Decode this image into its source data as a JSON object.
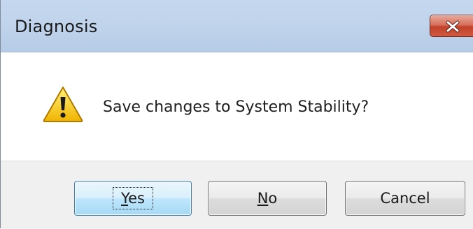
{
  "window": {
    "title": "Diagnosis"
  },
  "message": "Save changes to System Stability?",
  "buttons": {
    "yes": {
      "accel": "Y",
      "rest": "es"
    },
    "no": {
      "accel": "N",
      "rest": "o"
    },
    "cancel": {
      "label": "Cancel"
    }
  },
  "icons": {
    "close": "close-icon",
    "warning": "warning-icon"
  },
  "colors": {
    "titlebar": "#c0d4ec",
    "close_button": "#c8452d",
    "footer": "#f0f0f0",
    "default_button_border": "#3c7fb1",
    "warning_yellow": "#f5c400"
  }
}
